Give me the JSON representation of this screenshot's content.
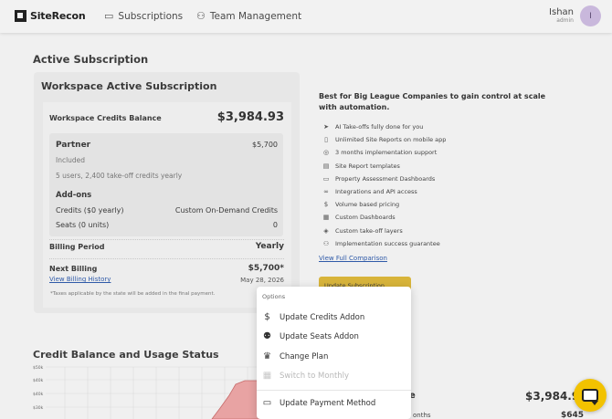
{
  "header": {
    "logo_text": "SiteRecon",
    "nav": [
      {
        "label": "Subscriptions",
        "icon": "credit-card-icon"
      },
      {
        "label": "Team Management",
        "icon": "team-icon"
      }
    ],
    "user": {
      "name": "Ishan",
      "role": "admin",
      "initial": "I"
    }
  },
  "active_subscription": {
    "section_title": "Active Subscription",
    "card_title": "Workspace Active Subscription",
    "credits_balance_label": "Workspace Credits Balance",
    "credits_balance_value": "$3,984.93",
    "partner": {
      "title": "Partner",
      "price": "$5,700",
      "included_label": "Included",
      "included_detail": "5 users, 2,400 take-off credits yearly"
    },
    "addons": {
      "title": "Add-ons",
      "credits_label": "Credits ($0 yearly)",
      "credits_value": "Custom On-Demand Credits",
      "seats_label": "Seats (0 units)",
      "seats_value": "0"
    },
    "billing_period_label": "Billing Period",
    "billing_period_value": "Yearly",
    "next_billing_label": "Next Billing",
    "next_billing_value": "$5,700*",
    "view_billing_history": "View Billing History",
    "next_billing_date": "May 28, 2026",
    "tax_note": "*Taxes applicable by the state will be added in the final payment."
  },
  "plan_info": {
    "headline": "Best for Big League Companies to gain control at scale with automation.",
    "features": [
      {
        "icon": "send-icon",
        "label": "AI Take-offs fully done for you"
      },
      {
        "icon": "mobile-icon",
        "label": "Unlimited Site Reports on mobile app"
      },
      {
        "icon": "globe-icon",
        "label": "3 months implementation support"
      },
      {
        "icon": "document-icon",
        "label": "Site Report templates"
      },
      {
        "icon": "monitor-icon",
        "label": "Property Assessment Dashboards"
      },
      {
        "icon": "link-icon",
        "label": "Integrations and API access"
      },
      {
        "icon": "dollar-icon",
        "label": "Volume based pricing"
      },
      {
        "icon": "dashboard-icon",
        "label": "Custom Dashboards"
      },
      {
        "icon": "layers-icon",
        "label": "Custom take-off layers"
      },
      {
        "icon": "user-check-icon",
        "label": "Implementation success guarantee"
      }
    ],
    "view_full_comparison": "View Full Comparison",
    "update_subscription_button": "Update Subscription"
  },
  "credit_usage": {
    "section_title": "Credit Balance and Usage Status",
    "y_ticks": [
      "$50k",
      "$40k",
      "$40k",
      "$30k"
    ],
    "right_value_large": "$3,984.9",
    "right_value_small": "$645",
    "right_partial_label": "e",
    "right_partial_months": "onths"
  },
  "options_menu": {
    "header": "Options",
    "items": [
      {
        "label": "Update Credits Addon",
        "icon": "dollar-circle-icon",
        "enabled": true
      },
      {
        "label": "Update Seats Addon",
        "icon": "user-plus-icon",
        "enabled": true
      },
      {
        "label": "Change Plan",
        "icon": "crown-icon",
        "enabled": true
      },
      {
        "label": "Switch to Monthly",
        "icon": "calendar-icon",
        "enabled": false
      },
      {
        "label": "Update Payment Method",
        "icon": "credit-card-icon",
        "enabled": true
      }
    ]
  },
  "colors": {
    "accent_yellow": "#d8b43a",
    "chat_yellow": "#f2c200",
    "link_blue": "#2f5aa8",
    "avatar_bg": "#c9b8dc",
    "chart_fill": "#e8a3a3"
  }
}
